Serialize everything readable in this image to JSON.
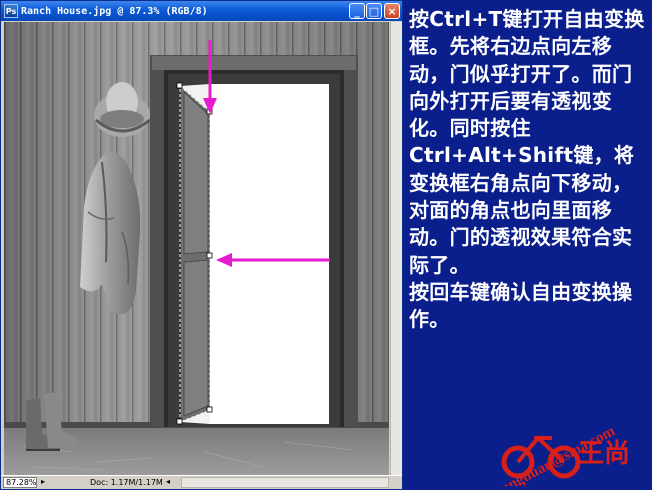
{
  "window": {
    "title": "Ranch House.jpg @ 87.3% (RGB/8)",
    "minimize_glyph": "_",
    "maximize_glyph": "□",
    "close_glyph": "×"
  },
  "status_bar": {
    "zoom": "87.28%",
    "arrow_glyph": "▸",
    "doc_size": "Doc: 1.17M/1.17M",
    "nav_glyph": "◂"
  },
  "instructions": [
    "按Ctrl+T键打开自由变换框。先将右边点向左移动，门似乎打开了。而门向外打开后要有透视变化。同时按住Ctrl+Alt+Shift键，将变换框右角点向下移动，对面的角点也向里面移动。门的透视效果符合实际了。",
    "按回车键确认自由变换操作。"
  ],
  "watermark": {
    "text": "wangduan@sina.com",
    "logo_text": "王尚"
  },
  "colors": {
    "background": "#0a1e8c",
    "text": "#ffffff",
    "arrow": "#e81ad0",
    "title_bar": "#0a5ad6"
  },
  "icons": {
    "document": "photoshop-document-icon",
    "arrows": "pink-arrow-icon"
  }
}
